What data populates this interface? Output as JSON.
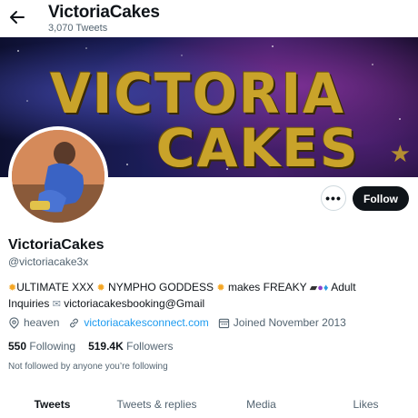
{
  "header": {
    "title": "VictoriaCakes",
    "tweet_count": "3,070 Tweets",
    "back_icon": "arrow-left-icon"
  },
  "banner": {
    "line1": "VICTORIA",
    "line2": "CAKES"
  },
  "actions": {
    "more_label": "•••",
    "follow_label": "Follow"
  },
  "profile": {
    "name": "VictoriaCakes",
    "handle": "@victoriacake3x",
    "bio": {
      "part1": "ULTIMATE XXX",
      "part2": "NYMPHO GODDESS",
      "part3": "makes FREAKY",
      "part4": "Adult",
      "part5": "Inquiries",
      "part6": "victoriacakesbooking@Gmail"
    },
    "location": "heaven",
    "website": "victoriacakesconnect.com",
    "joined": "Joined November 2013"
  },
  "stats": {
    "following_count": "550",
    "following_label": "Following",
    "followers_count": "519.4K",
    "followers_label": "Followers"
  },
  "not_followed_text": "Not followed by anyone you’re following",
  "tabs": [
    {
      "label": "Tweets",
      "active": true
    },
    {
      "label": "Tweets & replies",
      "active": false
    },
    {
      "label": "Media",
      "active": false
    },
    {
      "label": "Likes",
      "active": false
    }
  ],
  "colors": {
    "accent": "#1d9bf0",
    "text": "#0f1419",
    "muted": "#536471",
    "follow_bg": "#0f1419"
  }
}
